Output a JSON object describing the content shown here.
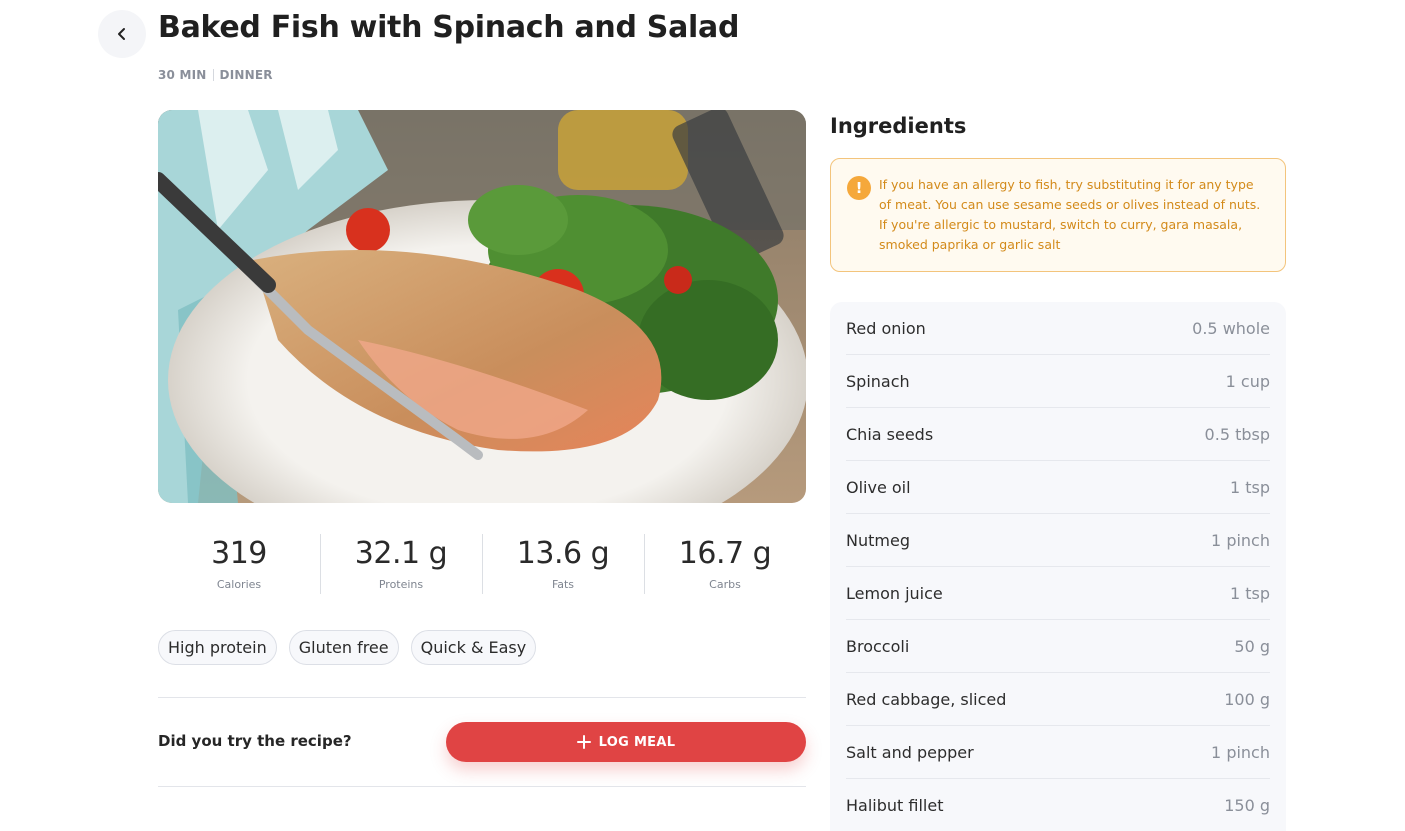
{
  "header": {
    "title": "Baked Fish with Spinach and Salad",
    "duration": "30 MIN",
    "meal_type": "DINNER"
  },
  "nutrition": [
    {
      "value": "319",
      "label": "Calories"
    },
    {
      "value": "32.1 g",
      "label": "Proteins"
    },
    {
      "value": "13.6 g",
      "label": "Fats"
    },
    {
      "value": "16.7 g",
      "label": "Carbs"
    }
  ],
  "tags": [
    "High protein",
    "Gluten free",
    "Quick & Easy"
  ],
  "log": {
    "question": "Did you try the recipe?",
    "button_label": "LOG MEAL"
  },
  "ingredients": {
    "title": "Ingredients",
    "allergy_note": "If you have an allergy to fish, try substituting it for any type of meat. You can use sesame seeds or olives instead of nuts. If you're allergic to mustard, switch to curry, gara masala, smoked paprika or garlic salt",
    "items": [
      {
        "name": "Red onion",
        "qty": "0.5 whole"
      },
      {
        "name": "Spinach",
        "qty": "1 cup"
      },
      {
        "name": "Chia seeds",
        "qty": "0.5 tbsp"
      },
      {
        "name": "Olive oil",
        "qty": "1 tsp"
      },
      {
        "name": "Nutmeg",
        "qty": "1 pinch"
      },
      {
        "name": "Lemon juice",
        "qty": "1 tsp"
      },
      {
        "name": "Broccoli",
        "qty": "50 g"
      },
      {
        "name": "Red cabbage, sliced",
        "qty": "100 g"
      },
      {
        "name": "Salt and pepper",
        "qty": "1 pinch"
      },
      {
        "name": "Halibut fillet",
        "qty": "150 g"
      }
    ]
  },
  "colors": {
    "accent": "#e04444",
    "warning_border": "#f3c47c",
    "warning_text": "#d38a1a"
  }
}
